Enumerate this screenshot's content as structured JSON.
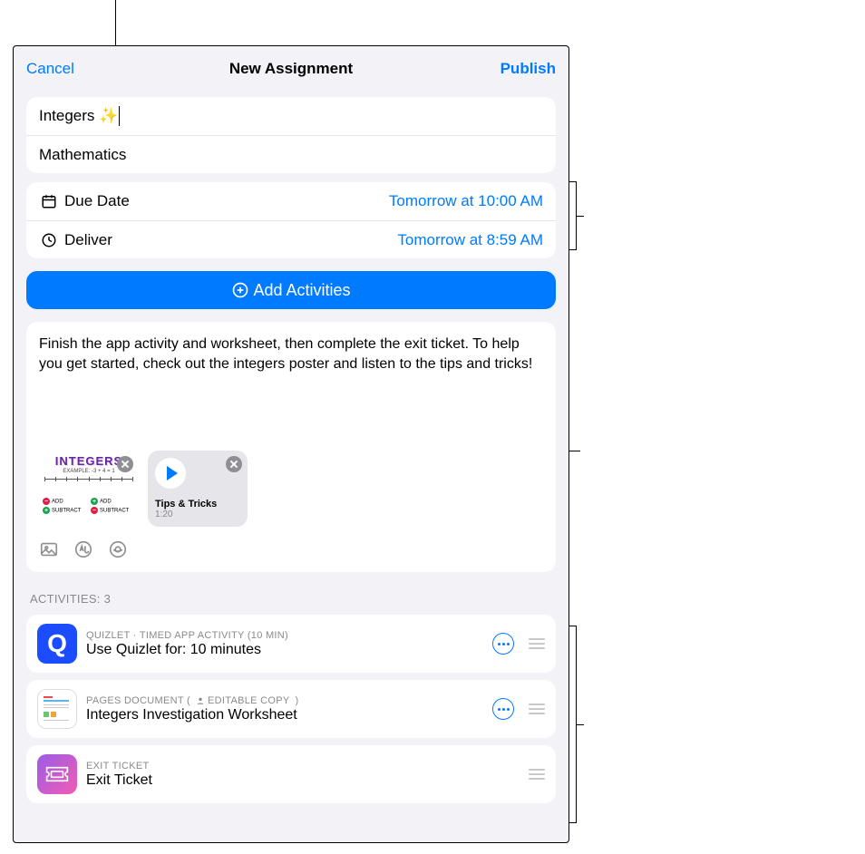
{
  "header": {
    "cancel": "Cancel",
    "title": "New Assignment",
    "publish": "Publish"
  },
  "assignment": {
    "title": "Integers ✨",
    "class": "Mathematics"
  },
  "schedule": {
    "due_label": "Due Date",
    "due_value": "Tomorrow at 10:00 AM",
    "deliver_label": "Deliver",
    "deliver_value": "Tomorrow at 8:59 AM"
  },
  "add_activities_label": "Add Activities",
  "instructions": "Finish the app activity and worksheet, then complete the exit ticket. To help you get started, check out the integers poster and listen to the tips and tricks!",
  "attachments": {
    "poster_title": "INTEGERS",
    "poster_example": "EXAMPLE: -3 + 4 = 1",
    "poster_legend_add": "ADD",
    "poster_legend_sub": "SUBTRACT",
    "audio_name": "Tips & Tricks",
    "audio_duration": "1:20"
  },
  "activities_header": "ACTIVITIES: 3",
  "activities": [
    {
      "meta": "QUIZLET · TIMED APP ACTIVITY (10 MIN)",
      "title": "Use Quizlet for: 10 minutes"
    },
    {
      "meta_prefix": "PAGES DOCUMENT  (",
      "meta_badge": "EDITABLE COPY",
      "meta_suffix": ")",
      "title": "Integers Investigation Worksheet"
    },
    {
      "meta": "EXIT TICKET",
      "title": "Exit Ticket"
    }
  ]
}
